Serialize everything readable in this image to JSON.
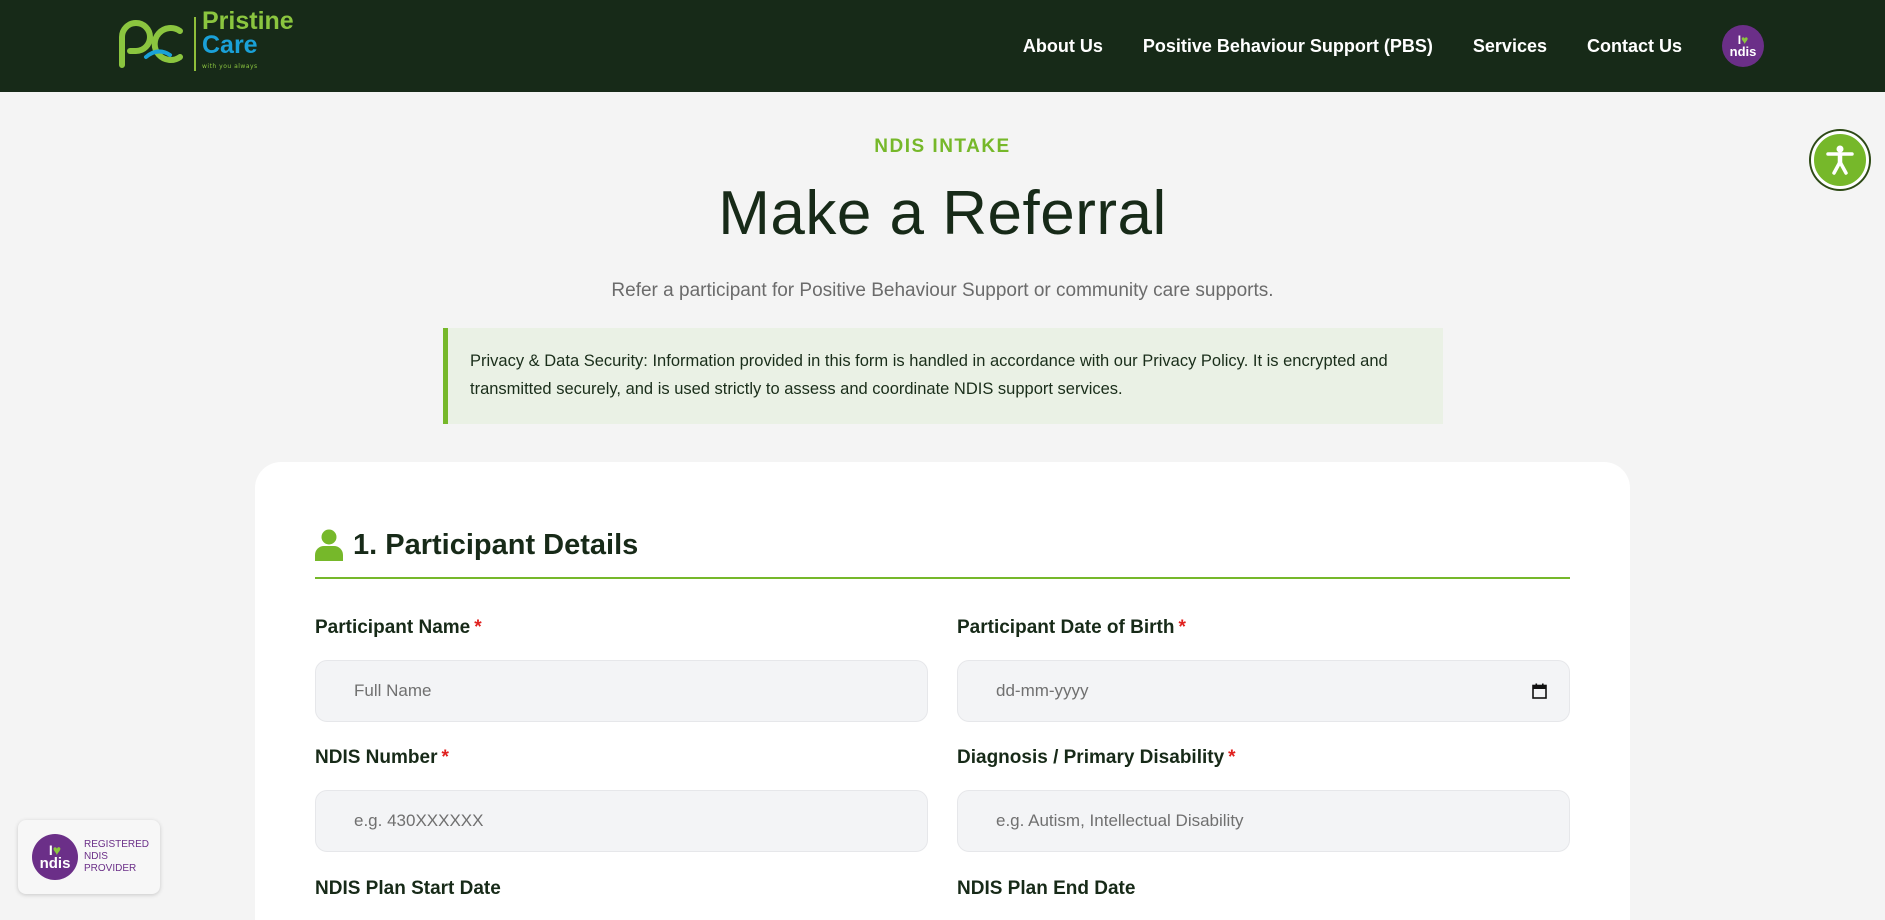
{
  "header": {
    "logo": {
      "line1": "Pristine",
      "line2": "Care",
      "tagline": "with you always"
    },
    "nav": [
      {
        "label": "About Us"
      },
      {
        "label": "Positive Behaviour Support (PBS)"
      },
      {
        "label": "Services"
      },
      {
        "label": "Contact Us"
      }
    ],
    "ndis_badge": {
      "line1": "I",
      "line2": "ndis"
    }
  },
  "accessibility": {
    "icon": "accessibility-icon"
  },
  "hero": {
    "eyebrow": "NDIS INTAKE",
    "title": "Make a Referral",
    "subtitle": "Refer a participant for Positive Behaviour Support or community care supports."
  },
  "privacy": {
    "text": "Privacy & Data Security: Information provided in this form is handled in accordance with our Privacy Policy. It is encrypted and transmitted securely, and is used strictly to assess and coordinate NDIS support services."
  },
  "form": {
    "section1": {
      "title": "1. Participant Details",
      "icon": "user-icon"
    },
    "fields": {
      "name": {
        "label": "Participant Name",
        "required": "*",
        "placeholder": "Full Name"
      },
      "dob": {
        "label": "Participant Date of Birth",
        "required": "*",
        "placeholder": "dd-mm-yyyy"
      },
      "ndis_number": {
        "label": "NDIS Number",
        "required": "*",
        "placeholder": "e.g. 430XXXXXX"
      },
      "diagnosis": {
        "label": "Diagnosis / Primary Disability",
        "required": "*",
        "placeholder": "e.g. Autism, Intellectual Disability"
      },
      "plan_start": {
        "label": "NDIS Plan Start Date"
      },
      "plan_end": {
        "label": "NDIS Plan End Date"
      }
    }
  },
  "provider_badge": {
    "line1": "I",
    "line2": "ndis",
    "text1": "REGISTERED",
    "text2": "NDIS",
    "text3": "PROVIDER"
  },
  "colors": {
    "header_bg": "#172a18",
    "accent_green": "#76b82a",
    "ndis_purple": "#6b2f88",
    "required_red": "#e0201e"
  }
}
